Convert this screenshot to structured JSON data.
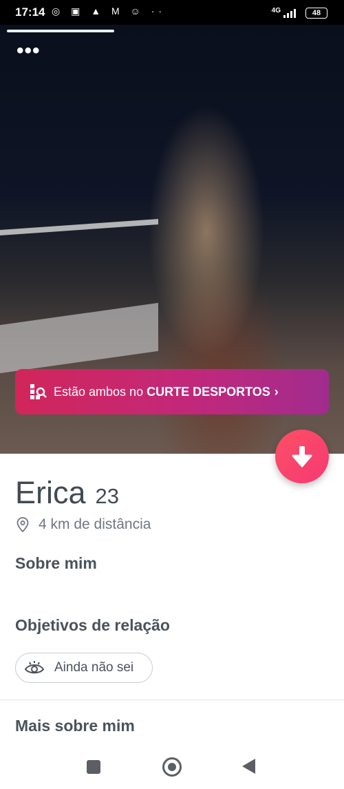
{
  "status_bar": {
    "time": "17:14",
    "network": "4G",
    "battery": "48"
  },
  "photo": {
    "alt": "Profile photo"
  },
  "banner": {
    "prefix": "Estão ambos no",
    "highlight": "CURTE DESPORTOS",
    "chevron": "›"
  },
  "profile": {
    "name": "Erica",
    "age": "23",
    "distance": "4 km de distância"
  },
  "sections": {
    "about_title": "Sobre mim",
    "goals_title": "Objetivos de relação",
    "goal_chip": "Ainda não sei",
    "more_title": "Mais sobre mim"
  },
  "icons": {
    "menu": "more-dots-icon",
    "fab": "arrow-down-icon",
    "location": "location-pin-icon",
    "goal": "eye-icon",
    "banner": "interest-icon"
  },
  "colors": {
    "accent": "#f43a72",
    "banner_start": "#d1265a",
    "banner_end": "#a12c8e",
    "text": "#424a52"
  }
}
